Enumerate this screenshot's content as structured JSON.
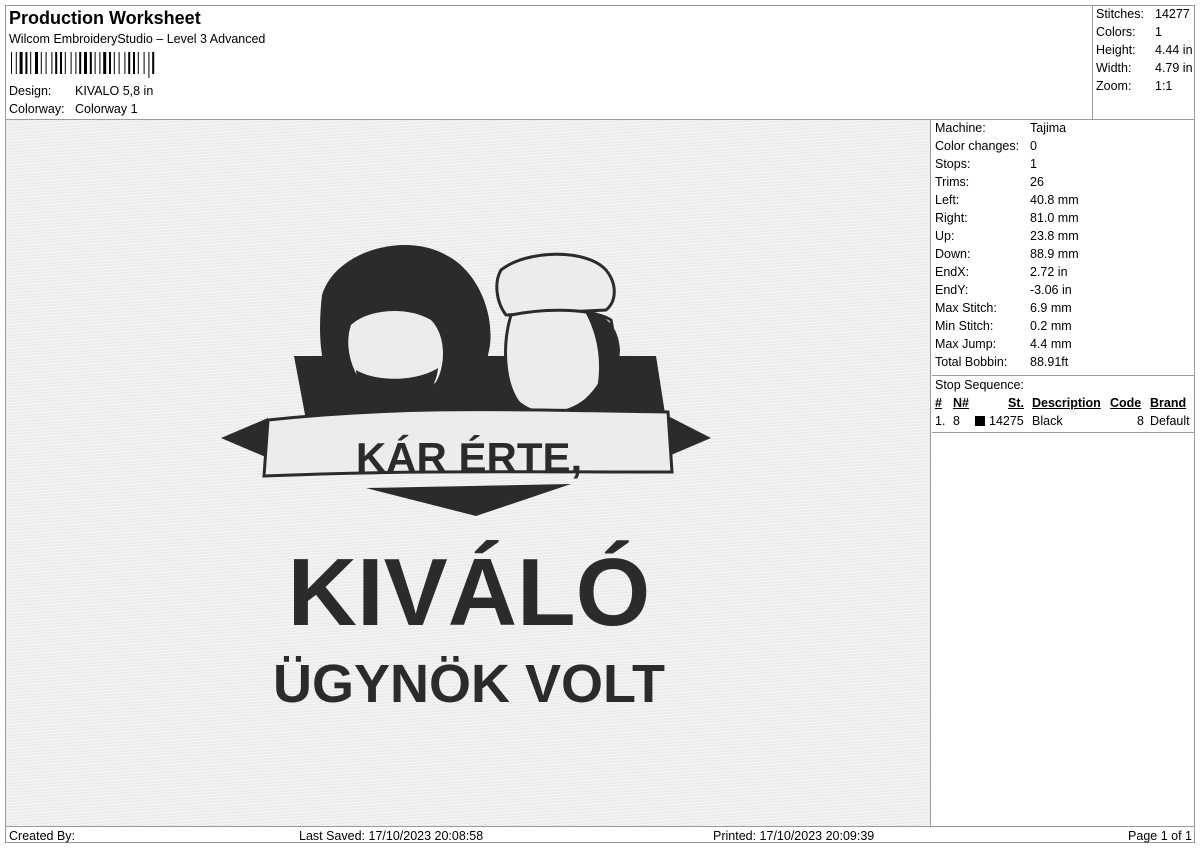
{
  "header": {
    "title": "Production Worksheet",
    "software": "Wilcom EmbroideryStudio – Level 3 Advanced",
    "design_label": "Design:",
    "design_value": "KIVALO 5,8 in",
    "colorway_label": "Colorway:",
    "colorway_value": "Colorway 1"
  },
  "stats": [
    {
      "label": "Stitches:",
      "value": "14277"
    },
    {
      "label": "Colors:",
      "value": "1"
    },
    {
      "label": "Height:",
      "value": "4.44 in"
    },
    {
      "label": "Width:",
      "value": "4.79 in"
    },
    {
      "label": "Zoom:",
      "value": "1:1"
    }
  ],
  "machine_info": [
    {
      "label": "Machine:",
      "value": "Tajima"
    },
    {
      "label": "Color changes:",
      "value": "0"
    },
    {
      "label": "Stops:",
      "value": "1"
    },
    {
      "label": "Trims:",
      "value": "26"
    },
    {
      "label": "Left:",
      "value": "40.8 mm"
    },
    {
      "label": "Right:",
      "value": "81.0 mm"
    },
    {
      "label": "Up:",
      "value": "23.8 mm"
    },
    {
      "label": "Down:",
      "value": "88.9 mm"
    },
    {
      "label": "EndX:",
      "value": "2.72 in"
    },
    {
      "label": "EndY:",
      "value": "-3.06 in"
    },
    {
      "label": "Max Stitch:",
      "value": "6.9 mm"
    },
    {
      "label": "Min Stitch:",
      "value": "0.2 mm"
    },
    {
      "label": "Max Jump:",
      "value": "4.4 mm"
    },
    {
      "label": "Total Bobbin:",
      "value": "88.91ft"
    }
  ],
  "stop_sequence": {
    "title": "Stop Sequence:",
    "columns": [
      "#",
      "N#",
      "St.",
      "Description",
      "Code",
      "Brand"
    ],
    "rows": [
      {
        "index": "1.",
        "n": "8",
        "stitches": "14275",
        "description": "Black",
        "code": "8",
        "brand": "Default",
        "color": "#000000"
      }
    ]
  },
  "design_text": {
    "banner": "KÁR ÉRTE,",
    "line1": "KIVÁLÓ",
    "line2": "ÜGYNÖK VOLT"
  },
  "footer": {
    "created_by": "Created By:",
    "last_saved": "Last Saved: 17/10/2023 20:08:58",
    "printed": "Printed: 17/10/2023 20:09:39",
    "page": "Page 1 of 1"
  },
  "colors": {
    "thread": "#2b2b2b",
    "fabric": "#ececec"
  }
}
